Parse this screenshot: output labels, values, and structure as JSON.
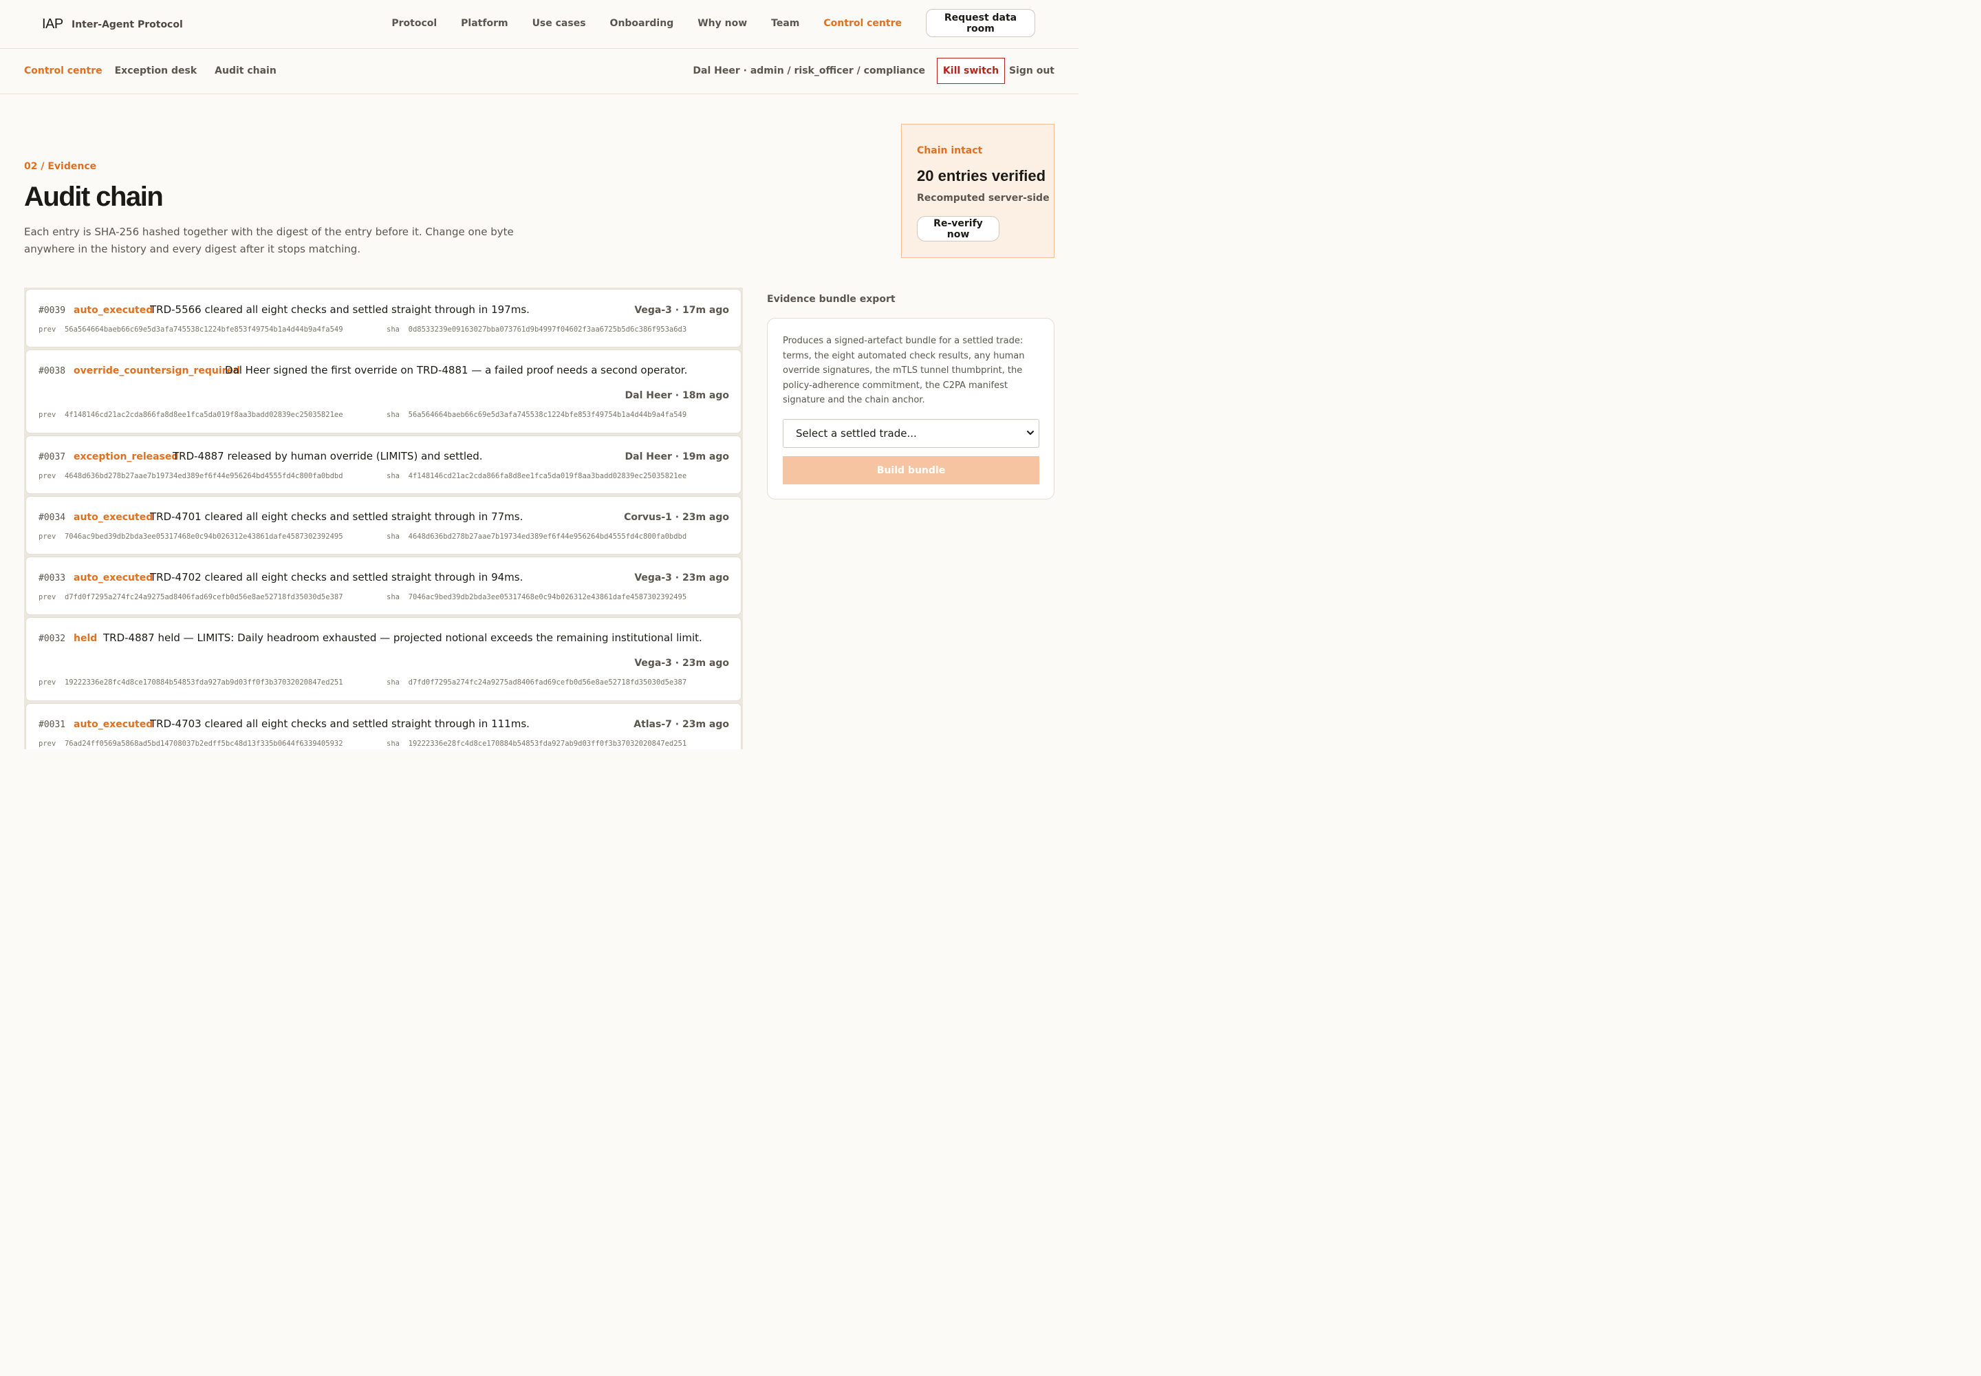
{
  "brand": {
    "logo": "IAP",
    "name": "Inter-Agent Protocol"
  },
  "nav": {
    "items": [
      "Protocol",
      "Platform",
      "Use cases",
      "Onboarding",
      "Why now",
      "Team",
      "Control centre"
    ],
    "active": "Control centre",
    "cta": "Request data room"
  },
  "subnav": {
    "items": [
      "Control centre",
      "Exception desk",
      "Audit chain"
    ],
    "active": "Control centre",
    "user": "Dal Heer · admin / risk_officer / compliance",
    "kill_switch": "Kill switch",
    "sign_out": "Sign out"
  },
  "hero": {
    "eyebrow": "02 / Evidence",
    "title": "Audit chain",
    "lede": "Each entry is SHA-256 hashed together with the digest of the entry before it. Change one byte anywhere in the history and every digest after it stops matching."
  },
  "chain_status": {
    "status": "Chain intact",
    "count": "20 entries verified",
    "sub": "Recomputed server-side",
    "button": "Re-verify now"
  },
  "entries": [
    {
      "num": "#0039",
      "tag": "auto_executed",
      "desc": "TRD-5566 cleared all eight checks and settled straight through in 197ms.",
      "meta": "Vega-3 · 17m ago",
      "prev_label": "prev",
      "prev": "56a564664baeb66c69e5d3afa745538c1224bfe853f49754b1a4d44b9a4fa549",
      "sha_label": "sha",
      "sha": "0d8533239e09163027bba073761d9b4997f04602f3aa6725b5d6c386f953a6d3"
    },
    {
      "num": "#0038",
      "tag": "override_countersign_required",
      "desc": "Dal Heer signed the first override on TRD-4881 — a failed proof needs a second operator.",
      "meta": "Dal Heer · 18m ago",
      "prev_label": "prev",
      "prev": "4f148146cd21ac2cda866fa8d8ee1fca5da019f8aa3badd02839ec25035821ee",
      "sha_label": "sha",
      "sha": "56a564664baeb66c69e5d3afa745538c1224bfe853f49754b1a4d44b9a4fa549"
    },
    {
      "num": "#0037",
      "tag": "exception_released",
      "desc": "TRD-4887 released by human override (LIMITS) and settled.",
      "meta": "Dal Heer · 19m ago",
      "prev_label": "prev",
      "prev": "4648d636bd278b27aae7b19734ed389ef6f44e956264bd4555fd4c800fa0bdbd",
      "sha_label": "sha",
      "sha": "4f148146cd21ac2cda866fa8d8ee1fca5da019f8aa3badd02839ec25035821ee"
    },
    {
      "num": "#0034",
      "tag": "auto_executed",
      "desc": "TRD-4701 cleared all eight checks and settled straight through in 77ms.",
      "meta": "Corvus-1 · 23m ago",
      "prev_label": "prev",
      "prev": "7046ac9bed39db2bda3ee05317468e0c94b026312e43861dafe4587302392495",
      "sha_label": "sha",
      "sha": "4648d636bd278b27aae7b19734ed389ef6f44e956264bd4555fd4c800fa0bdbd"
    },
    {
      "num": "#0033",
      "tag": "auto_executed",
      "desc": "TRD-4702 cleared all eight checks and settled straight through in 94ms.",
      "meta": "Vega-3 · 23m ago",
      "prev_label": "prev",
      "prev": "d7fd0f7295a274fc24a9275ad8406fad69cefb0d56e8ae52718fd35030d5e387",
      "sha_label": "sha",
      "sha": "7046ac9bed39db2bda3ee05317468e0c94b026312e43861dafe4587302392495"
    },
    {
      "num": "#0032",
      "tag": "held",
      "desc": "TRD-4887 held — LIMITS: Daily headroom exhausted — projected notional exceeds the remaining institutional limit.",
      "meta": "Vega-3 · 23m ago",
      "prev_label": "prev",
      "prev": "19222336e28fc4d8ce170884b54853fda927ab9d03ff0f3b37032020847ed251",
      "sha_label": "sha",
      "sha": "d7fd0f7295a274fc24a9275ad8406fad69cefb0d56e8ae52718fd35030d5e387"
    },
    {
      "num": "#0031",
      "tag": "auto_executed",
      "desc": "TRD-4703 cleared all eight checks and settled straight through in 111ms.",
      "meta": "Atlas-7 · 23m ago",
      "prev_label": "prev",
      "prev": "76ad24ff0569a5868ad5bd14708037b2edff5bc48d13f335b0644f6339405932",
      "sha_label": "sha",
      "sha": "19222336e28fc4d8ce170884b54853fda927ab9d03ff0f3b37032020847ed251"
    }
  ],
  "export": {
    "title": "Evidence bundle export",
    "description": "Produces a signed-artefact bundle for a settled trade: terms, the eight automated check results, any human override signatures, the mTLS tunnel thumbprint, the policy-adherence commitment, the C2PA manifest signature and the chain anchor.",
    "select_value": "Select a settled trade...",
    "button": "Build bundle"
  },
  "colors": {
    "accent": "#e0701f",
    "danger": "#b3261e",
    "text": "#1c1a17",
    "muted": "#5a564e",
    "panel": "#fcefe3"
  }
}
